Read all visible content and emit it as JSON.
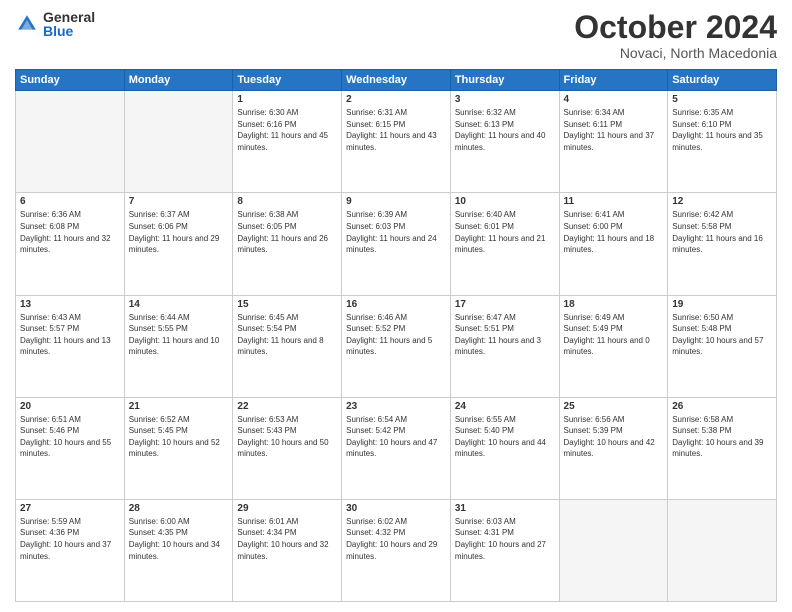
{
  "logo": {
    "general": "General",
    "blue": "Blue"
  },
  "header": {
    "month": "October 2024",
    "location": "Novaci, North Macedonia"
  },
  "days_of_week": [
    "Sunday",
    "Monday",
    "Tuesday",
    "Wednesday",
    "Thursday",
    "Friday",
    "Saturday"
  ],
  "weeks": [
    [
      {
        "day": "",
        "empty": true
      },
      {
        "day": "",
        "empty": true
      },
      {
        "day": "1",
        "sunrise": "Sunrise: 6:30 AM",
        "sunset": "Sunset: 6:16 PM",
        "daylight": "Daylight: 11 hours and 45 minutes."
      },
      {
        "day": "2",
        "sunrise": "Sunrise: 6:31 AM",
        "sunset": "Sunset: 6:15 PM",
        "daylight": "Daylight: 11 hours and 43 minutes."
      },
      {
        "day": "3",
        "sunrise": "Sunrise: 6:32 AM",
        "sunset": "Sunset: 6:13 PM",
        "daylight": "Daylight: 11 hours and 40 minutes."
      },
      {
        "day": "4",
        "sunrise": "Sunrise: 6:34 AM",
        "sunset": "Sunset: 6:11 PM",
        "daylight": "Daylight: 11 hours and 37 minutes."
      },
      {
        "day": "5",
        "sunrise": "Sunrise: 6:35 AM",
        "sunset": "Sunset: 6:10 PM",
        "daylight": "Daylight: 11 hours and 35 minutes."
      }
    ],
    [
      {
        "day": "6",
        "sunrise": "Sunrise: 6:36 AM",
        "sunset": "Sunset: 6:08 PM",
        "daylight": "Daylight: 11 hours and 32 minutes."
      },
      {
        "day": "7",
        "sunrise": "Sunrise: 6:37 AM",
        "sunset": "Sunset: 6:06 PM",
        "daylight": "Daylight: 11 hours and 29 minutes."
      },
      {
        "day": "8",
        "sunrise": "Sunrise: 6:38 AM",
        "sunset": "Sunset: 6:05 PM",
        "daylight": "Daylight: 11 hours and 26 minutes."
      },
      {
        "day": "9",
        "sunrise": "Sunrise: 6:39 AM",
        "sunset": "Sunset: 6:03 PM",
        "daylight": "Daylight: 11 hours and 24 minutes."
      },
      {
        "day": "10",
        "sunrise": "Sunrise: 6:40 AM",
        "sunset": "Sunset: 6:01 PM",
        "daylight": "Daylight: 11 hours and 21 minutes."
      },
      {
        "day": "11",
        "sunrise": "Sunrise: 6:41 AM",
        "sunset": "Sunset: 6:00 PM",
        "daylight": "Daylight: 11 hours and 18 minutes."
      },
      {
        "day": "12",
        "sunrise": "Sunrise: 6:42 AM",
        "sunset": "Sunset: 5:58 PM",
        "daylight": "Daylight: 11 hours and 16 minutes."
      }
    ],
    [
      {
        "day": "13",
        "sunrise": "Sunrise: 6:43 AM",
        "sunset": "Sunset: 5:57 PM",
        "daylight": "Daylight: 11 hours and 13 minutes."
      },
      {
        "day": "14",
        "sunrise": "Sunrise: 6:44 AM",
        "sunset": "Sunset: 5:55 PM",
        "daylight": "Daylight: 11 hours and 10 minutes."
      },
      {
        "day": "15",
        "sunrise": "Sunrise: 6:45 AM",
        "sunset": "Sunset: 5:54 PM",
        "daylight": "Daylight: 11 hours and 8 minutes."
      },
      {
        "day": "16",
        "sunrise": "Sunrise: 6:46 AM",
        "sunset": "Sunset: 5:52 PM",
        "daylight": "Daylight: 11 hours and 5 minutes."
      },
      {
        "day": "17",
        "sunrise": "Sunrise: 6:47 AM",
        "sunset": "Sunset: 5:51 PM",
        "daylight": "Daylight: 11 hours and 3 minutes."
      },
      {
        "day": "18",
        "sunrise": "Sunrise: 6:49 AM",
        "sunset": "Sunset: 5:49 PM",
        "daylight": "Daylight: 11 hours and 0 minutes."
      },
      {
        "day": "19",
        "sunrise": "Sunrise: 6:50 AM",
        "sunset": "Sunset: 5:48 PM",
        "daylight": "Daylight: 10 hours and 57 minutes."
      }
    ],
    [
      {
        "day": "20",
        "sunrise": "Sunrise: 6:51 AM",
        "sunset": "Sunset: 5:46 PM",
        "daylight": "Daylight: 10 hours and 55 minutes."
      },
      {
        "day": "21",
        "sunrise": "Sunrise: 6:52 AM",
        "sunset": "Sunset: 5:45 PM",
        "daylight": "Daylight: 10 hours and 52 minutes."
      },
      {
        "day": "22",
        "sunrise": "Sunrise: 6:53 AM",
        "sunset": "Sunset: 5:43 PM",
        "daylight": "Daylight: 10 hours and 50 minutes."
      },
      {
        "day": "23",
        "sunrise": "Sunrise: 6:54 AM",
        "sunset": "Sunset: 5:42 PM",
        "daylight": "Daylight: 10 hours and 47 minutes."
      },
      {
        "day": "24",
        "sunrise": "Sunrise: 6:55 AM",
        "sunset": "Sunset: 5:40 PM",
        "daylight": "Daylight: 10 hours and 44 minutes."
      },
      {
        "day": "25",
        "sunrise": "Sunrise: 6:56 AM",
        "sunset": "Sunset: 5:39 PM",
        "daylight": "Daylight: 10 hours and 42 minutes."
      },
      {
        "day": "26",
        "sunrise": "Sunrise: 6:58 AM",
        "sunset": "Sunset: 5:38 PM",
        "daylight": "Daylight: 10 hours and 39 minutes."
      }
    ],
    [
      {
        "day": "27",
        "sunrise": "Sunrise: 5:59 AM",
        "sunset": "Sunset: 4:36 PM",
        "daylight": "Daylight: 10 hours and 37 minutes."
      },
      {
        "day": "28",
        "sunrise": "Sunrise: 6:00 AM",
        "sunset": "Sunset: 4:35 PM",
        "daylight": "Daylight: 10 hours and 34 minutes."
      },
      {
        "day": "29",
        "sunrise": "Sunrise: 6:01 AM",
        "sunset": "Sunset: 4:34 PM",
        "daylight": "Daylight: 10 hours and 32 minutes."
      },
      {
        "day": "30",
        "sunrise": "Sunrise: 6:02 AM",
        "sunset": "Sunset: 4:32 PM",
        "daylight": "Daylight: 10 hours and 29 minutes."
      },
      {
        "day": "31",
        "sunrise": "Sunrise: 6:03 AM",
        "sunset": "Sunset: 4:31 PM",
        "daylight": "Daylight: 10 hours and 27 minutes."
      },
      {
        "day": "",
        "empty": true
      },
      {
        "day": "",
        "empty": true
      }
    ]
  ]
}
